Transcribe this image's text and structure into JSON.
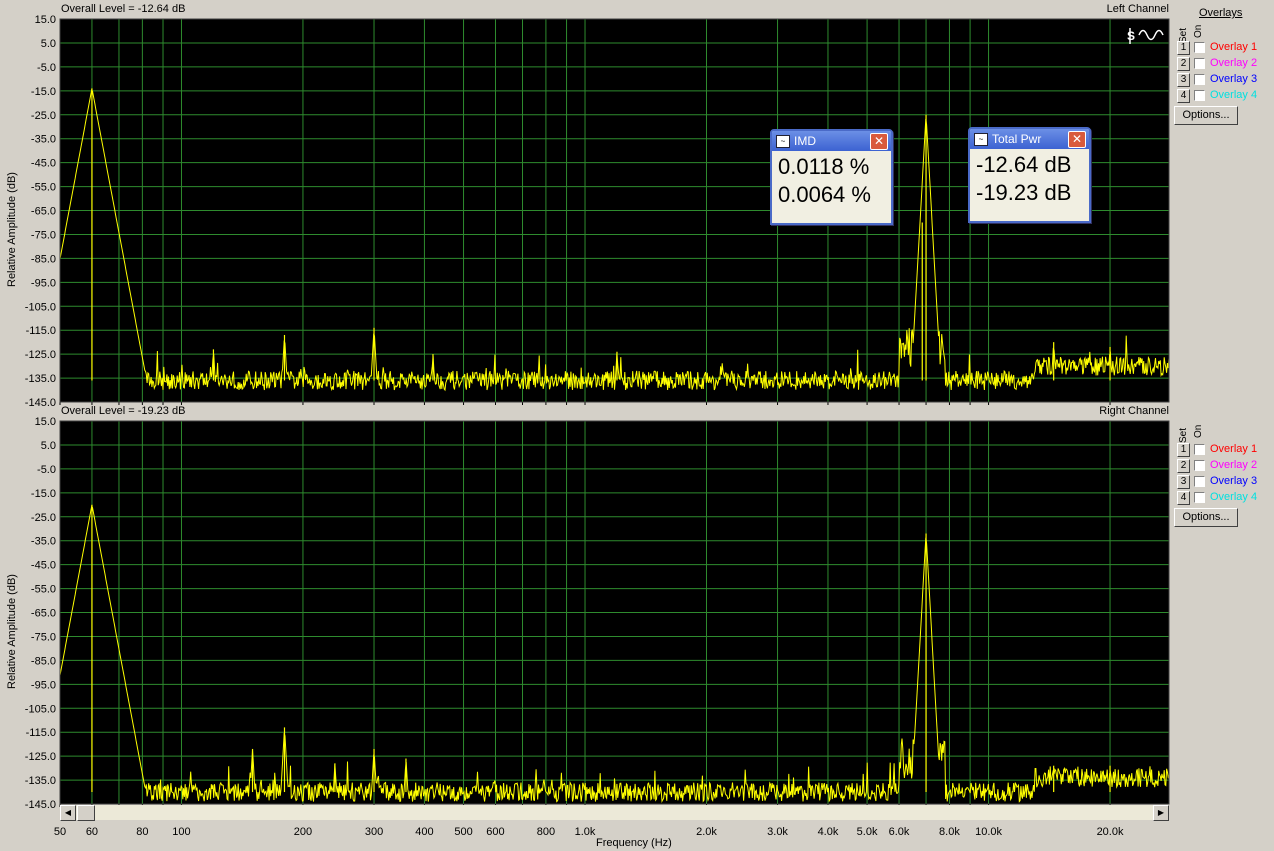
{
  "top": {
    "overall_level": "Overall Level = -12.64 dB",
    "channel": "Left Channel",
    "ylabel": "Relative Amplitude (dB)"
  },
  "bottom": {
    "overall_level": "Overall Level = -19.23 dB",
    "channel": "Right Channel",
    "ylabel": "Relative Amplitude (dB)"
  },
  "overlays_panel": {
    "title": "Overlays",
    "set_label": "Set",
    "on_label": "On",
    "options_label": "Options...",
    "items": [
      {
        "num": "1",
        "label": "Overlay 1",
        "color": "#ff0000"
      },
      {
        "num": "2",
        "label": "Overlay 2",
        "color": "#ff00ff"
      },
      {
        "num": "3",
        "label": "Overlay 3",
        "color": "#0000ff"
      },
      {
        "num": "4",
        "label": "Overlay 4",
        "color": "#00e0e0"
      }
    ]
  },
  "meters": {
    "imd": {
      "title": "IMD",
      "value1": "0.0118 %",
      "value2": "0.0064 %"
    },
    "total_pwr": {
      "title": "Total Pwr",
      "value1": "-12.64 dB",
      "value2": "-19.23 dB"
    }
  },
  "colors": {
    "plot_bg": "#000000",
    "grid": "#2e8b2e",
    "trace": "#ffff00"
  },
  "chart_data": [
    {
      "type": "line",
      "name": "Left Channel",
      "xlabel": "",
      "ylabel": "Relative Amplitude (dB)",
      "xscale": "log",
      "xlim": [
        50,
        28000
      ],
      "ylim": [
        -145,
        15
      ],
      "y_ticks": [
        "15.0",
        "5.0",
        "-5.0",
        "-15.0",
        "-25.0",
        "-35.0",
        "-45.0",
        "-55.0",
        "-65.0",
        "-75.0",
        "-85.0",
        "-95.0",
        "-105.0",
        "-115.0",
        "-125.0",
        "-135.0",
        "-145.0"
      ],
      "noise_floor_db": -136,
      "peaks": [
        {
          "f": 60,
          "db": -14
        },
        {
          "f": 120,
          "db": -123
        },
        {
          "f": 180,
          "db": -117
        },
        {
          "f": 300,
          "db": -114
        },
        {
          "f": 420,
          "db": -125
        },
        {
          "f": 1200,
          "db": -124
        },
        {
          "f": 6850,
          "db": -70
        },
        {
          "f": 7000,
          "db": -25
        },
        {
          "f": 14500,
          "db": -120
        },
        {
          "f": 20000,
          "db": -122
        }
      ]
    },
    {
      "type": "line",
      "name": "Right Channel",
      "xlabel": "Frequency (Hz)",
      "ylabel": "Relative Amplitude (dB)",
      "xscale": "log",
      "xlim": [
        50,
        28000
      ],
      "ylim": [
        -145,
        15
      ],
      "x_ticks": [
        "50",
        "60",
        "80",
        "100",
        "200",
        "300",
        "400",
        "500",
        "600",
        "800",
        "1.0k",
        "2.0k",
        "3.0k",
        "4.0k",
        "5.0k",
        "6.0k",
        "8.0k",
        "10.0k",
        "20.0k"
      ],
      "y_ticks": [
        "15.0",
        "5.0",
        "-5.0",
        "-15.0",
        "-25.0",
        "-35.0",
        "-45.0",
        "-55.0",
        "-65.0",
        "-75.0",
        "-85.0",
        "-95.0",
        "-105.0",
        "-115.0",
        "-125.0",
        "-135.0",
        "-145.0"
      ],
      "noise_floor_db": -140,
      "peaks": [
        {
          "f": 60,
          "db": -20
        },
        {
          "f": 150,
          "db": -122
        },
        {
          "f": 180,
          "db": -113
        },
        {
          "f": 240,
          "db": -128
        },
        {
          "f": 300,
          "db": -122
        },
        {
          "f": 360,
          "db": -126
        },
        {
          "f": 7000,
          "db": -32
        },
        {
          "f": 14500,
          "db": -129
        },
        {
          "f": 20000,
          "db": -129
        }
      ]
    }
  ]
}
